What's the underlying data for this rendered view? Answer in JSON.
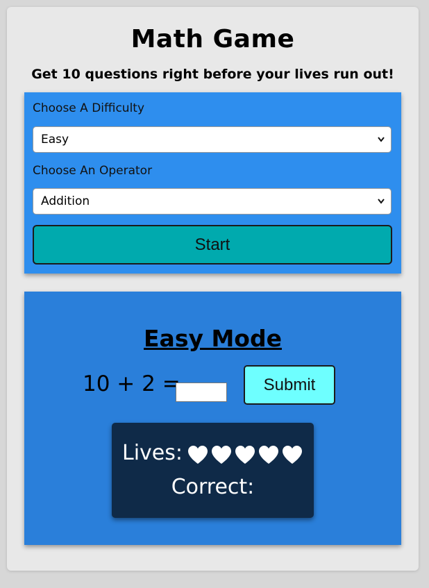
{
  "header": {
    "title": "Math Game",
    "subtitle": "Get 10 questions right before your lives run out!"
  },
  "settings": {
    "difficulty_label": "Choose A Difficulty",
    "difficulty_value": "Easy",
    "operator_label": "Choose An Operator",
    "operator_value": "Addition",
    "start_label": "Start"
  },
  "game": {
    "mode_title": "Easy Mode",
    "question": "10 + 2 =",
    "answer_value": "",
    "submit_label": "Submit",
    "lives_label": "Lives:",
    "lives_count": 5,
    "correct_label": "Correct:",
    "correct_value": ""
  },
  "icons": {
    "heart": "heart-icon",
    "select_arrow": "chevron-down-icon"
  },
  "colors": {
    "settings_panel": "#2e8eee",
    "game_panel": "#2a7fda",
    "start_button": "#00aaae",
    "submit_button": "#6effff",
    "stats_panel": "#0f2a48",
    "heart": "#ffffff"
  }
}
